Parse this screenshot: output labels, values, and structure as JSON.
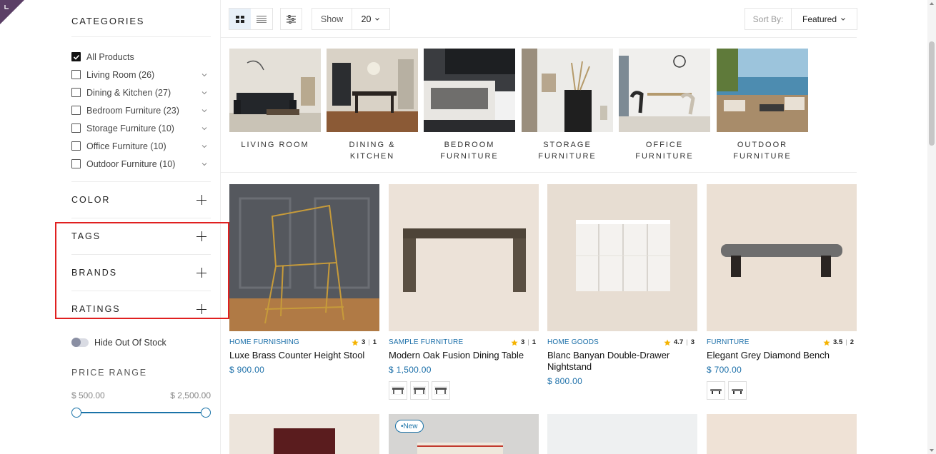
{
  "colors": {
    "accent": "#1a6ea8",
    "highlight_border": "#e02020",
    "corner_flag": "#5b3f66",
    "star": "#f5b301"
  },
  "sidebar": {
    "categories_title": "CATEGORIES",
    "categories": [
      {
        "label": "All Products",
        "checked": true
      },
      {
        "label": "Living Room (26)",
        "checked": false
      },
      {
        "label": "Dining & Kitchen (27)",
        "checked": false
      },
      {
        "label": "Bedroom Furniture (23)",
        "checked": false
      },
      {
        "label": "Storage Furniture (10)",
        "checked": false
      },
      {
        "label": "Office Furniture (10)",
        "checked": false
      },
      {
        "label": "Outdoor Furniture (10)",
        "checked": false
      }
    ],
    "filters": {
      "color": "COLOR",
      "tags": "TAGS",
      "brands": "BRANDS",
      "ratings": "RATINGS"
    },
    "hide_out_of_stock": "Hide Out Of Stock",
    "price_range": {
      "title": "PRICE RANGE",
      "min": "$ 500.00",
      "max": "$ 2,500.00"
    }
  },
  "toolbar": {
    "show_label": "Show",
    "show_value": "20",
    "sort_label": "Sort By:",
    "sort_value": "Featured"
  },
  "category_tiles": [
    {
      "label": "LIVING ROOM"
    },
    {
      "label": "DINING & KITCHEN"
    },
    {
      "label": "BEDROOM FURNITURE"
    },
    {
      "label": "STORAGE FURNITURE"
    },
    {
      "label": "OFFICE FURNITURE"
    },
    {
      "label": "OUTDOOR FURNITURE"
    }
  ],
  "products": [
    {
      "category": "HOME FURNISHING",
      "rating": "3",
      "reviews": "1",
      "name": "Luxe Brass Counter Height Stool",
      "price": "$ 900.00",
      "swatches": 0
    },
    {
      "category": "SAMPLE FURNITURE",
      "rating": "3",
      "reviews": "1",
      "name": "Modern Oak Fusion Dining Table",
      "price": "$ 1,500.00",
      "swatches": 3
    },
    {
      "category": "HOME GOODS",
      "rating": "4.7",
      "reviews": "3",
      "name": "Blanc Banyan Double-Drawer Nightstand",
      "price": "$ 800.00",
      "swatches": 0
    },
    {
      "category": "FURNITURE",
      "rating": "3.5",
      "reviews": "2",
      "name": "Elegant Grey Diamond Bench",
      "price": "$ 700.00",
      "swatches": 2
    }
  ],
  "second_row": {
    "new_badge": "New"
  }
}
